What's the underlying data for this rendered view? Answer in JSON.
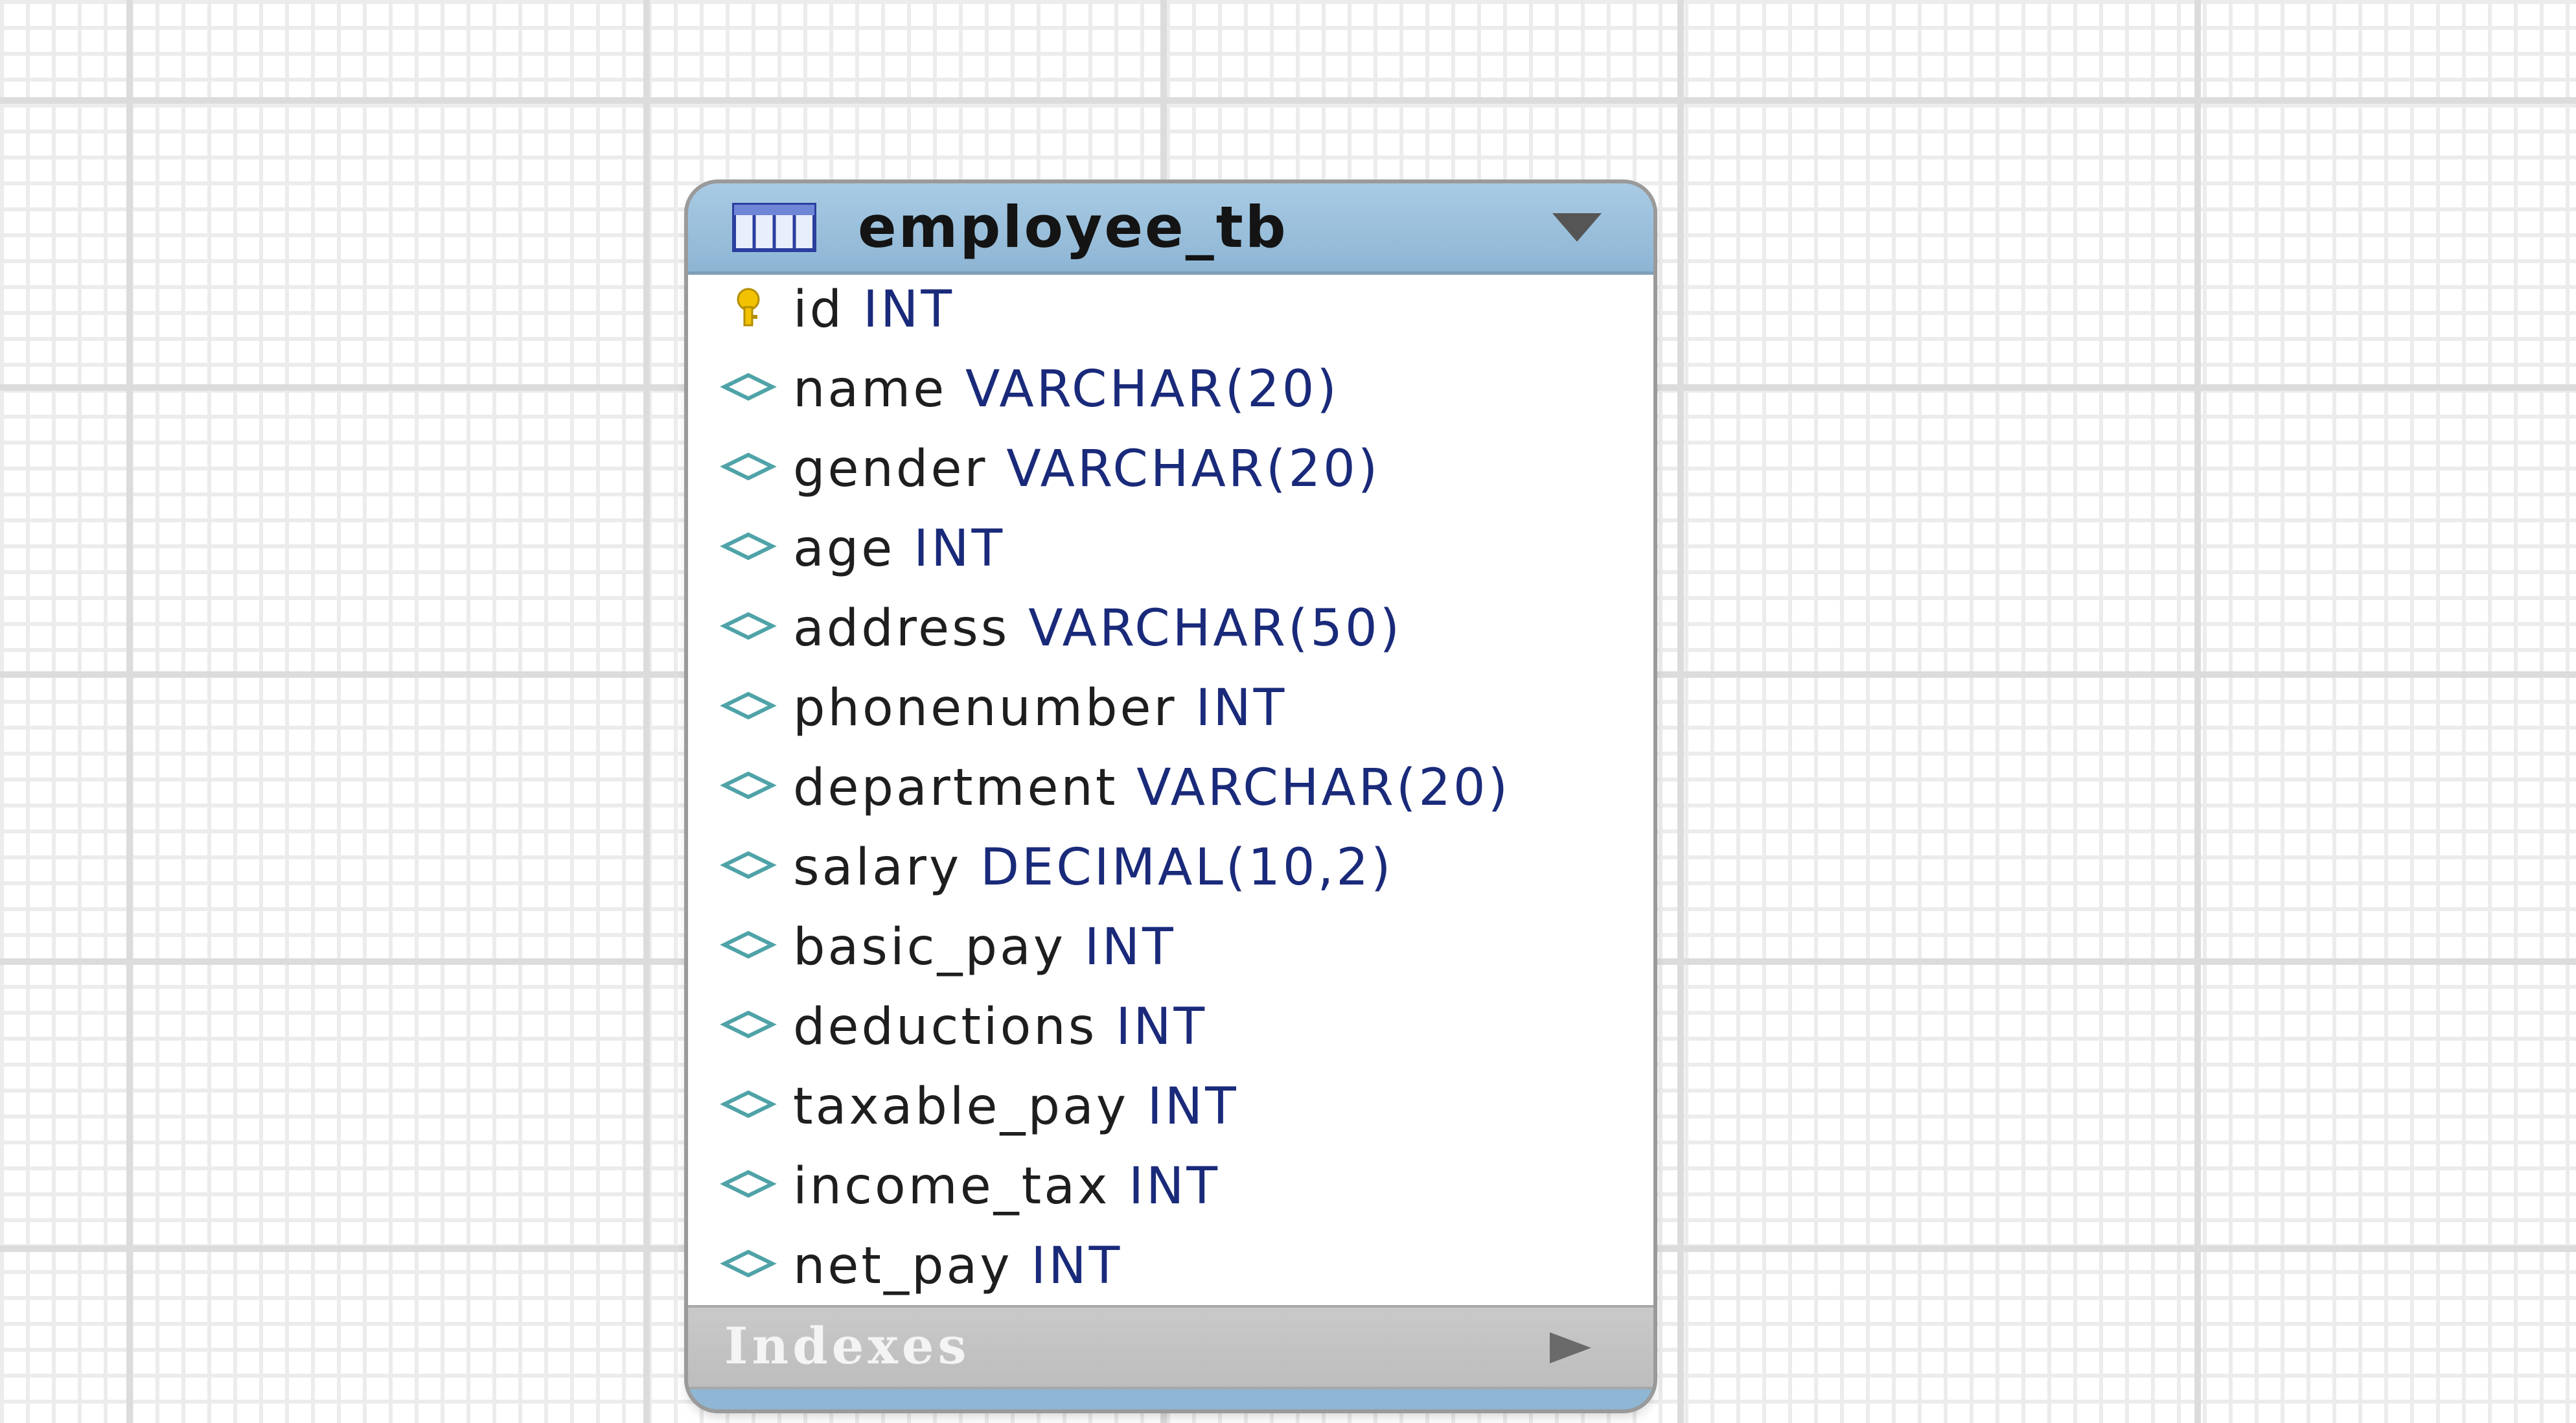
{
  "table": {
    "name": "employee_tb",
    "columns": [
      {
        "name": "id",
        "type": "INT",
        "primary_key": true
      },
      {
        "name": "name",
        "type": "VARCHAR(20)",
        "primary_key": false
      },
      {
        "name": "gender",
        "type": "VARCHAR(20)",
        "primary_key": false
      },
      {
        "name": "age",
        "type": "INT",
        "primary_key": false
      },
      {
        "name": "address",
        "type": "VARCHAR(50)",
        "primary_key": false
      },
      {
        "name": "phonenumber",
        "type": "INT",
        "primary_key": false
      },
      {
        "name": "department",
        "type": "VARCHAR(20)",
        "primary_key": false
      },
      {
        "name": "salary",
        "type": "DECIMAL(10,2)",
        "primary_key": false
      },
      {
        "name": "basic_pay",
        "type": "INT",
        "primary_key": false
      },
      {
        "name": "deductions",
        "type": "INT",
        "primary_key": false
      },
      {
        "name": "taxable_pay",
        "type": "INT",
        "primary_key": false
      },
      {
        "name": "income_tax",
        "type": "INT",
        "primary_key": false
      },
      {
        "name": "net_pay",
        "type": "INT",
        "primary_key": false
      }
    ],
    "indexes_label": "Indexes"
  },
  "icons": {
    "table": "table-icon",
    "primary_key": "key-icon",
    "column": "diamond-icon",
    "collapse": "triangle-down-icon",
    "expand": "triangle-right-icon"
  },
  "colors": {
    "header": "#8fb6d4",
    "type_text": "#1a2a7a",
    "key": "#f2c200",
    "column_diamond": "#4fa3a8"
  }
}
